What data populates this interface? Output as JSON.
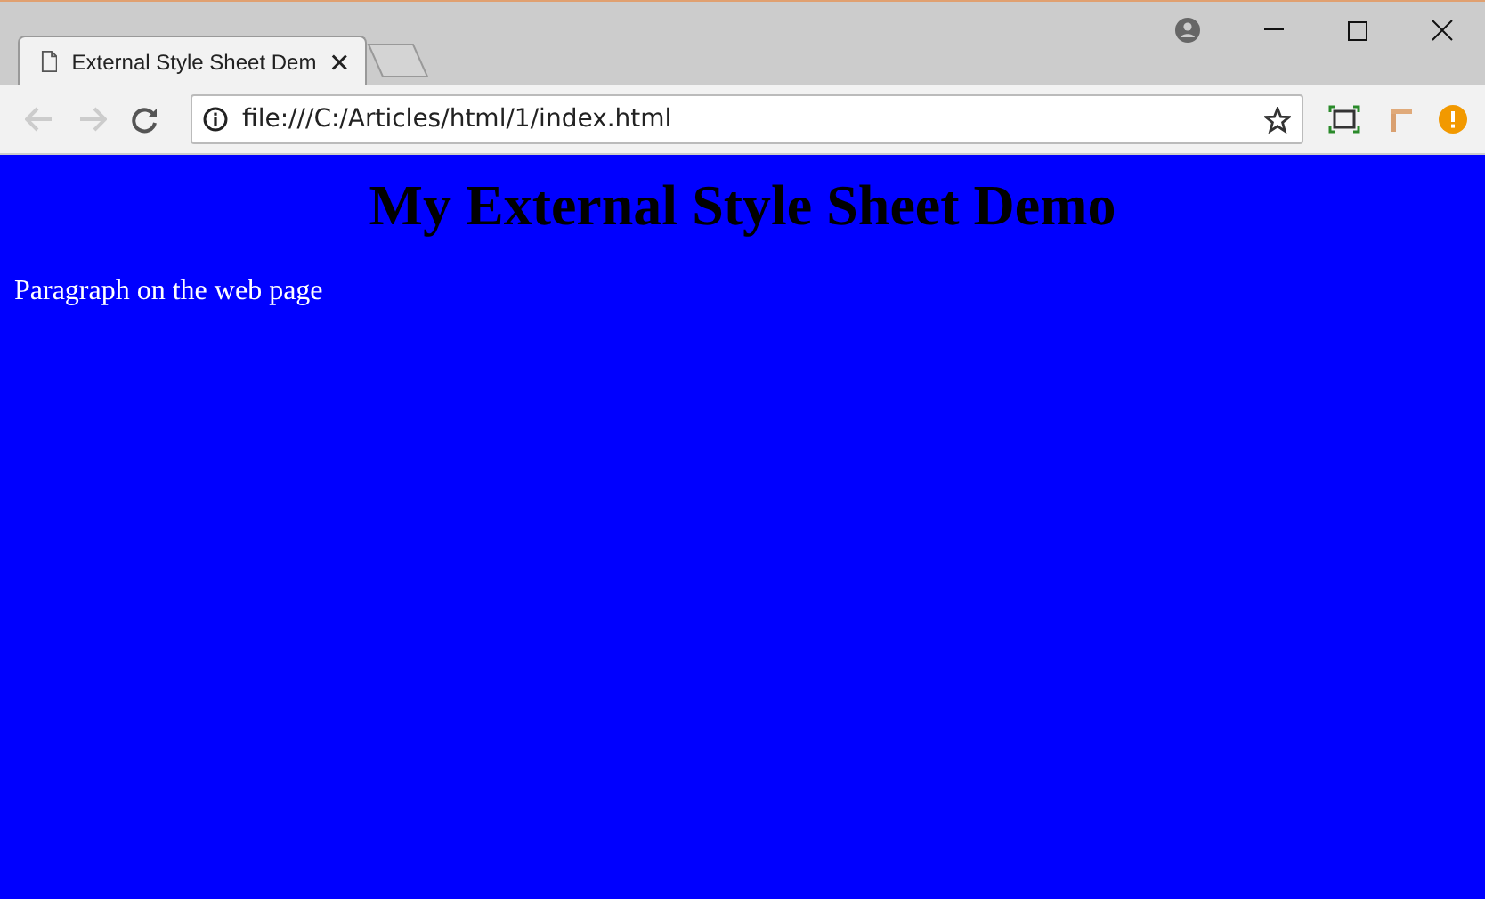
{
  "tabs": [
    {
      "title": "External Style Sheet Dem",
      "selected": true
    }
  ],
  "toolbar": {
    "back": {
      "disabled": true
    },
    "forward": {
      "disabled": true
    },
    "address": "file:///C:/Articles/html/1/index.html"
  },
  "page": {
    "heading": "My External Style Sheet Demo",
    "paragraph": "Paragraph on the web page"
  }
}
